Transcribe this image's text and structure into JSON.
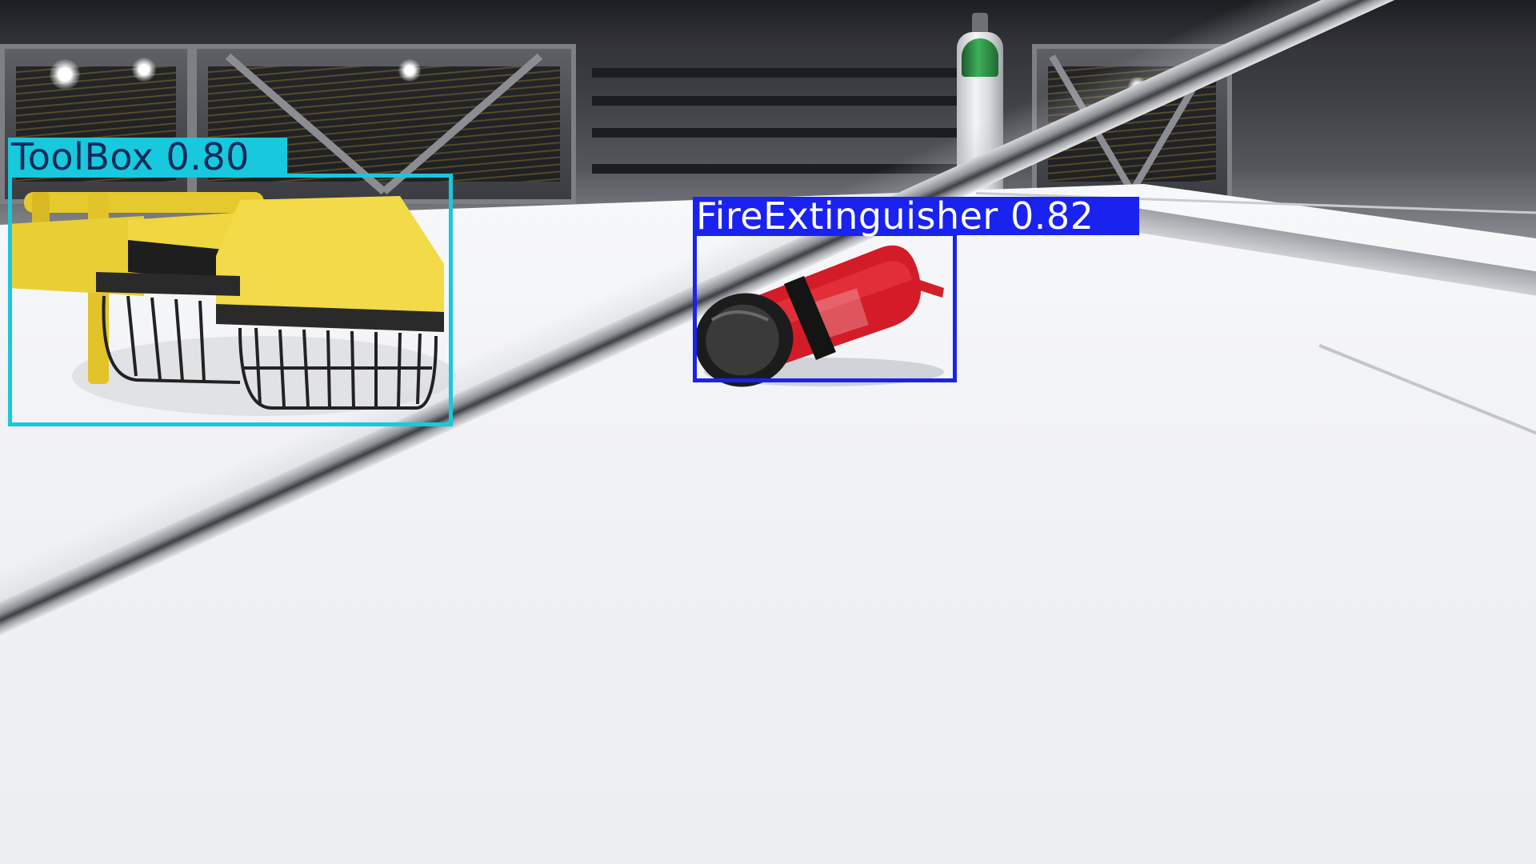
{
  "detections": [
    {
      "label": "ToolBox",
      "score": "0.80",
      "caption": "ToolBox 0.80",
      "box_color": "#18C8DC",
      "text_color": "#0D2A5A"
    },
    {
      "label": "FireExtinguisher",
      "score": "0.82",
      "caption": "FireExtinguisher 0.82",
      "box_color": "#1A22F0",
      "text_color": "#FFFFFF"
    }
  ]
}
